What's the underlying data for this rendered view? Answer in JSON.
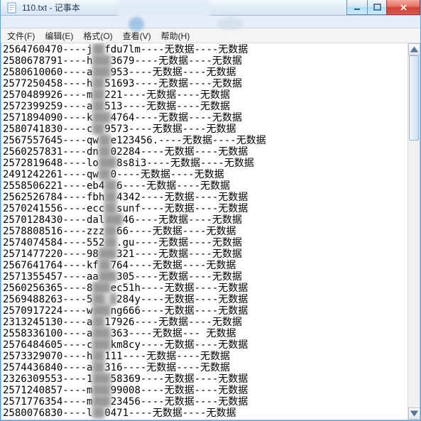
{
  "title": "110.txt - 记事本",
  "menu": {
    "file": "文件(F)",
    "edit": "编辑(E)",
    "format": "格式(O)",
    "view": "查看(V)",
    "help": "帮助(H)"
  },
  "nodata": "无数据",
  "sep": "----",
  "lines": [
    {
      "id": "2564760470",
      "m1": "j",
      "blur": "██",
      "m2": "fdu7lm",
      "t1": "----",
      "t2": "----"
    },
    {
      "id": "2580678791",
      "m1": "h",
      "blur": "███",
      "m2": "3679",
      "t1": "----",
      "t2": "----"
    },
    {
      "id": "2580610060",
      "m1": "a",
      "blur": "███",
      "m2": "953",
      "t1": "----",
      "t2": "----"
    },
    {
      "id": "2577250458",
      "m1": "h",
      "blur": "██",
      "m2": "51693",
      "t1": "----",
      "t2": "----"
    },
    {
      "id": "2570489926",
      "m1": "m",
      "blur": "██",
      "m2": "221",
      "t1": "----",
      "t2": "----"
    },
    {
      "id": "2572399259",
      "m1": "a",
      "blur": "██",
      "m2": "513",
      "t1": "----",
      "t2": "----"
    },
    {
      "id": "2571894090",
      "m1": "k",
      "blur": "███",
      "m2": "4764",
      "t1": "----",
      "t2": "----"
    },
    {
      "id": "2580741830",
      "m1": "c",
      "blur": "██",
      "m2": "9573",
      "t1": "----",
      "t2": "----"
    },
    {
      "id": "2567557645",
      "m1": "qw",
      "blur": "██",
      "m2": "e123456.",
      "t1": "----",
      "t2": "----",
      "wide": true
    },
    {
      "id": "2560257831",
      "m1": "dn",
      "blur": "██",
      "m2": "02284",
      "t1": "----",
      "t2": "----"
    },
    {
      "id": "2572819648",
      "m1": "lo",
      "blur": "███",
      "m2": "8s8i3",
      "t1": "----",
      "t2": "----",
      "wide": true
    },
    {
      "id": "2491242261",
      "m1": "qw",
      "blur": "██",
      "m2": "0",
      "t1": "----",
      "t2": "----",
      "short": true
    },
    {
      "id": "2558506221",
      "m1": "eb4",
      "blur": "██",
      "m2": "6",
      "t1": "----",
      "t2": "----",
      "short": true
    },
    {
      "id": "2562526784",
      "m1": "fbh",
      "blur": "██",
      "m2": "4342",
      "t1": "----",
      "t2": "----"
    },
    {
      "id": "2570241556",
      "m1": "ecc",
      "blur": "██",
      "m2": "sunf",
      "t1": "----",
      "t2": "----"
    },
    {
      "id": "2570128430",
      "m1": "dal",
      "blur": "███",
      "m2": "46",
      "t1": "----",
      "t2": "----"
    },
    {
      "id": "2578808516",
      "m1": "zzz",
      "blur": "██",
      "m2": "66",
      "t1": "----",
      "t2": "----"
    },
    {
      "id": "2574074584",
      "m1": "552",
      "blur": "██",
      "m2": ".gu",
      "t1": "----",
      "t2": "----"
    },
    {
      "id": "2571477220",
      "m1": "98",
      "blur": "███",
      "m2": "321",
      "t1": "----",
      "t2": "----"
    },
    {
      "id": "2567641764",
      "m1": "kf",
      "blur": "██",
      "m2": "764",
      "t1": "----",
      "t2": "----"
    },
    {
      "id": "2571355457",
      "m1": "aa",
      "blur": "███",
      "m2": "305",
      "t1": "----",
      "t2": "----",
      "wide": true
    },
    {
      "id": "2560256365",
      "m1": "8",
      "blur": "███",
      "m2": "ec51h",
      "t1": "----",
      "t2": "----"
    },
    {
      "id": "2569488263",
      "m1": "5",
      "blur": "██ █",
      "m2": "284y",
      "t1": "----",
      "t2": "----"
    },
    {
      "id": "2570917224",
      "m1": "w",
      "blur": "███",
      "m2": "ng666",
      "t1": "----",
      "t2": "----"
    },
    {
      "id": "2313245130",
      "m1": "a",
      "blur": "██",
      "m2": "17926",
      "t1": "----",
      "t2": "----"
    },
    {
      "id": "2558336100",
      "m1": "a",
      "blur": "███",
      "m2": "363",
      "t1": "----",
      "t2": "---",
      "sepg": " "
    },
    {
      "id": "2576484605",
      "m1": "c",
      "blur": "███",
      "m2": "km8cy",
      "t1": "----",
      "t2": "----"
    },
    {
      "id": "2573329070",
      "m1": "h",
      "blur": "██",
      "m2": "111",
      "t1": "----",
      "t2": "----",
      "short": true
    },
    {
      "id": "2574436840",
      "m1": "a",
      "blur": "██",
      "m2": "316",
      "t1": "----",
      "t2": "----"
    },
    {
      "id": "2326309553",
      "m1": "1",
      "blur": "███",
      "m2": "58369",
      "t1": "----",
      "t2": "----"
    },
    {
      "id": "2571240857",
      "m1": "m",
      "blur": "███",
      "m2": "99008",
      "t1": "----",
      "t2": "----"
    },
    {
      "id": "2571776354",
      "m1": "m",
      "blur": "███",
      "m2": "23456",
      "t1": "----",
      "t2": "----"
    },
    {
      "id": "2580076830",
      "m1": "l",
      "blur": "██",
      "m2": "0471",
      "t1": "----",
      "t2": "----"
    }
  ]
}
